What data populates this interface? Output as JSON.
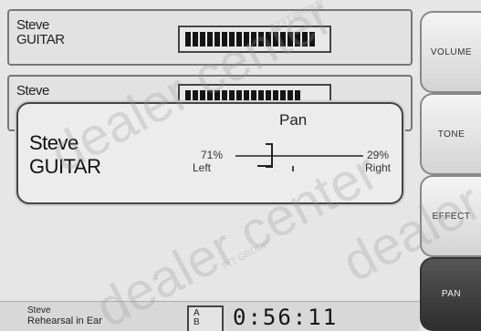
{
  "channels": [
    {
      "name_line1": "Steve",
      "name_line2": "GUITAR",
      "level": 0.88
    },
    {
      "name_line1": "Steve",
      "name_line2": "",
      "level": 0.8
    }
  ],
  "popup": {
    "name_line1": "Steve",
    "name_line2": "GUITAR",
    "title": "Pan",
    "left_value": "71%",
    "left_label": "Left",
    "right_value": "29%",
    "right_label": "Right",
    "pan_position": 0.29
  },
  "side_buttons": [
    {
      "label": "VOLUME",
      "active": false
    },
    {
      "label": "TONE",
      "active": false
    },
    {
      "label": "EFFECT",
      "active": false
    },
    {
      "label": "PAN",
      "active": true
    }
  ],
  "status": {
    "name": "Steve",
    "subtitle": "Rehearsal in Ear",
    "icon_text": "A\nB",
    "time": "0:56:11"
  },
  "watermark": {
    "brand": "dealer center",
    "group": "TTT GROUP"
  }
}
